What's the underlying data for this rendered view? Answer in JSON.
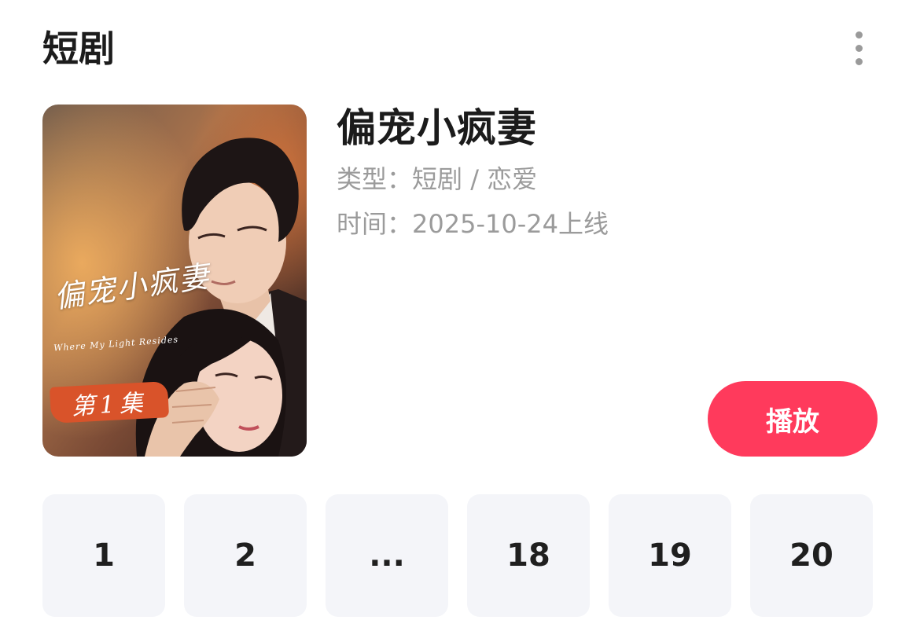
{
  "header": {
    "title": "短剧",
    "more_icon": "more-vertical-icon"
  },
  "drama": {
    "title": "偏宠小疯妻",
    "genre_label": "类型：",
    "genre_value": "短剧 / 恋爱",
    "time_label": "时间：",
    "time_value": "2025-10-24上线",
    "play_label": "播放"
  },
  "poster": {
    "overlay_title": "偏宠小疯妻",
    "overlay_subtitle": "Where My Light Resides",
    "episode_tag": "第1集"
  },
  "episodes": [
    {
      "label": "1"
    },
    {
      "label": "2"
    },
    {
      "label": "..."
    },
    {
      "label": "18"
    },
    {
      "label": "19"
    },
    {
      "label": "20"
    }
  ],
  "colors": {
    "accent": "#ff3a5c",
    "muted_text": "#9b9b9b",
    "cell_background": "#f4f5f9"
  }
}
